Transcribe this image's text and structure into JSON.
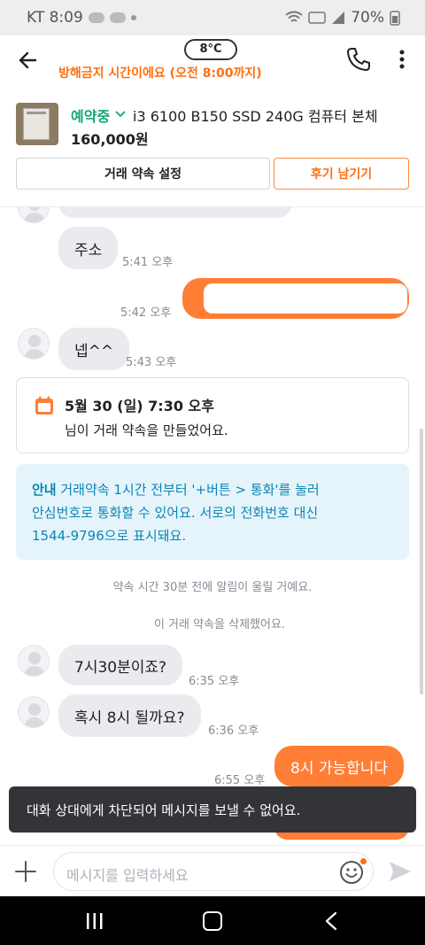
{
  "status_bar": {
    "carrier_time": "KT 8:09",
    "battery": "70%",
    "icons": [
      "wifi-icon",
      "lte-icon",
      "signal-icon",
      "battery-icon"
    ]
  },
  "header": {
    "weather": "8°C",
    "subtitle": "방해금지 시간이에요 (오전 8:00까지)",
    "icons": [
      "back-arrow-icon",
      "phone-icon",
      "more-vertical-icon"
    ]
  },
  "product": {
    "status": "예약중",
    "title": "i3 6100 B150 SSD 240G 컴퓨터 본체",
    "price": "160,000원",
    "appointment_button": "거래 약속 설정",
    "review_button": "후기 남기기"
  },
  "messages": {
    "address_bubble": "주소",
    "address_time": "5:41 오후",
    "outgoing_time_1": "5:42 오후",
    "ok_bubble": "넵^^",
    "ok_time": "5:43 오후",
    "appointment_card": {
      "date": "5월 30 (일) 7:30 오후",
      "text": "님이 거래 약속을 만들었어요."
    },
    "notice": {
      "strong": "안내",
      "line1": " 거래약속 1시간 전부터 '+버튼 > 통화'를 눌러",
      "line2": "안심번호로 통화할 수 있어요. 서로의 전화번호 대신",
      "line3": "1544-9796으로 표시돼요."
    },
    "system_alarm": "약속 시간 30분 전에 알림이 울릴 거예요.",
    "system_deleted": "이 거래 약속을 삭제했어요.",
    "question_bubble": "7시30분이죠?",
    "question_time": "6:35 오후",
    "question2_bubble": "혹시 8시 될까요?",
    "question2_time": "6:36 오후",
    "reply_bubble": "8시 가능합니다",
    "reply_time": "6:55 오후"
  },
  "toast": "대화 상대에게 차단되어 메시지를 보낼 수 없어요.",
  "input": {
    "placeholder": "메시지를 입력하세요"
  },
  "colors": {
    "brand_orange": "#ff6f0f",
    "status_green": "#11a675",
    "notice_blue": "#0a86b5"
  }
}
